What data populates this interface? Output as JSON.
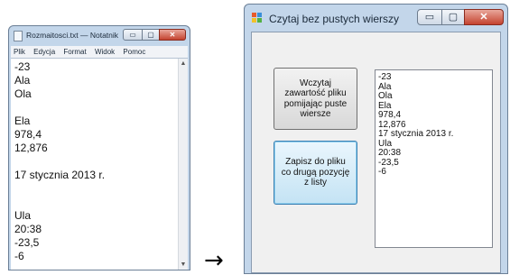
{
  "notepad": {
    "title": "Rozmaitosci.txt — Notatnik",
    "buttons": {
      "minimize": "▭",
      "maximize": "▢",
      "close": "✕"
    },
    "menu": [
      "Plik",
      "Edycja",
      "Format",
      "Widok",
      "Pomoc"
    ],
    "content": "-23\nAla\nOla\n\nEla\n978,4\n12,876\n\n17 stycznia 2013 r.\n\n\nUla\n20:38\n-23,5\n-6",
    "scroll_up": "▲",
    "scroll_down": "▼"
  },
  "arrow": "→",
  "form": {
    "title": "Czytaj bez pustych wierszy",
    "buttons": {
      "minimize": "▭",
      "maximize": "▢",
      "close": "✕"
    },
    "read_button": "Wczytaj\nzawartość pliku\npomijając puste\nwiersze",
    "save_button": "Zapisz do pliku\nco drugą pozycję\nz listy",
    "list_items": [
      "-23",
      "Ala",
      "Ola",
      "Ela",
      "978,4",
      "12,876",
      "17 stycznia 2013 r.",
      "Ula",
      "20:38",
      "-23,5",
      "-6"
    ]
  }
}
